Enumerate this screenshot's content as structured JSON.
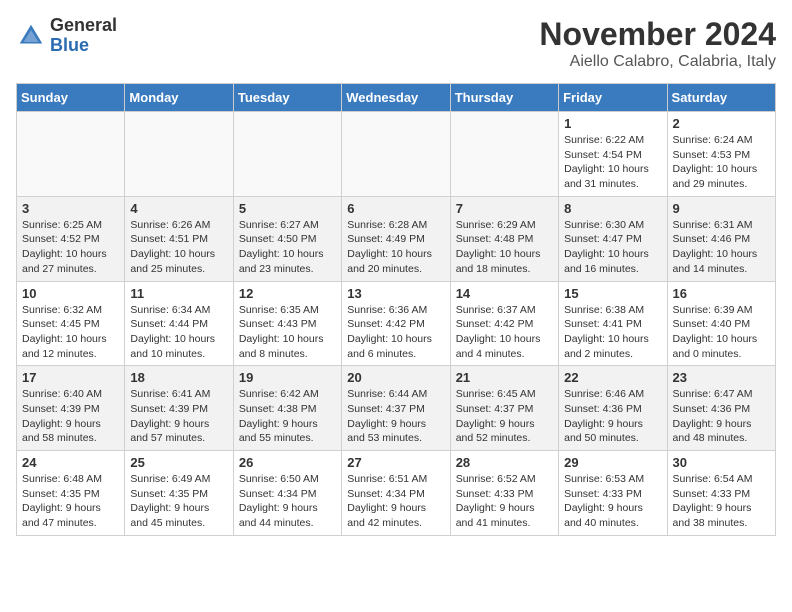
{
  "logo": {
    "general": "General",
    "blue": "Blue"
  },
  "title": "November 2024",
  "location": "Aiello Calabro, Calabria, Italy",
  "headers": [
    "Sunday",
    "Monday",
    "Tuesday",
    "Wednesday",
    "Thursday",
    "Friday",
    "Saturday"
  ],
  "weeks": [
    [
      {
        "day": "",
        "info": ""
      },
      {
        "day": "",
        "info": ""
      },
      {
        "day": "",
        "info": ""
      },
      {
        "day": "",
        "info": ""
      },
      {
        "day": "",
        "info": ""
      },
      {
        "day": "1",
        "info": "Sunrise: 6:22 AM\nSunset: 4:54 PM\nDaylight: 10 hours and 31 minutes."
      },
      {
        "day": "2",
        "info": "Sunrise: 6:24 AM\nSunset: 4:53 PM\nDaylight: 10 hours and 29 minutes."
      }
    ],
    [
      {
        "day": "3",
        "info": "Sunrise: 6:25 AM\nSunset: 4:52 PM\nDaylight: 10 hours and 27 minutes."
      },
      {
        "day": "4",
        "info": "Sunrise: 6:26 AM\nSunset: 4:51 PM\nDaylight: 10 hours and 25 minutes."
      },
      {
        "day": "5",
        "info": "Sunrise: 6:27 AM\nSunset: 4:50 PM\nDaylight: 10 hours and 23 minutes."
      },
      {
        "day": "6",
        "info": "Sunrise: 6:28 AM\nSunset: 4:49 PM\nDaylight: 10 hours and 20 minutes."
      },
      {
        "day": "7",
        "info": "Sunrise: 6:29 AM\nSunset: 4:48 PM\nDaylight: 10 hours and 18 minutes."
      },
      {
        "day": "8",
        "info": "Sunrise: 6:30 AM\nSunset: 4:47 PM\nDaylight: 10 hours and 16 minutes."
      },
      {
        "day": "9",
        "info": "Sunrise: 6:31 AM\nSunset: 4:46 PM\nDaylight: 10 hours and 14 minutes."
      }
    ],
    [
      {
        "day": "10",
        "info": "Sunrise: 6:32 AM\nSunset: 4:45 PM\nDaylight: 10 hours and 12 minutes."
      },
      {
        "day": "11",
        "info": "Sunrise: 6:34 AM\nSunset: 4:44 PM\nDaylight: 10 hours and 10 minutes."
      },
      {
        "day": "12",
        "info": "Sunrise: 6:35 AM\nSunset: 4:43 PM\nDaylight: 10 hours and 8 minutes."
      },
      {
        "day": "13",
        "info": "Sunrise: 6:36 AM\nSunset: 4:42 PM\nDaylight: 10 hours and 6 minutes."
      },
      {
        "day": "14",
        "info": "Sunrise: 6:37 AM\nSunset: 4:42 PM\nDaylight: 10 hours and 4 minutes."
      },
      {
        "day": "15",
        "info": "Sunrise: 6:38 AM\nSunset: 4:41 PM\nDaylight: 10 hours and 2 minutes."
      },
      {
        "day": "16",
        "info": "Sunrise: 6:39 AM\nSunset: 4:40 PM\nDaylight: 10 hours and 0 minutes."
      }
    ],
    [
      {
        "day": "17",
        "info": "Sunrise: 6:40 AM\nSunset: 4:39 PM\nDaylight: 9 hours and 58 minutes."
      },
      {
        "day": "18",
        "info": "Sunrise: 6:41 AM\nSunset: 4:39 PM\nDaylight: 9 hours and 57 minutes."
      },
      {
        "day": "19",
        "info": "Sunrise: 6:42 AM\nSunset: 4:38 PM\nDaylight: 9 hours and 55 minutes."
      },
      {
        "day": "20",
        "info": "Sunrise: 6:44 AM\nSunset: 4:37 PM\nDaylight: 9 hours and 53 minutes."
      },
      {
        "day": "21",
        "info": "Sunrise: 6:45 AM\nSunset: 4:37 PM\nDaylight: 9 hours and 52 minutes."
      },
      {
        "day": "22",
        "info": "Sunrise: 6:46 AM\nSunset: 4:36 PM\nDaylight: 9 hours and 50 minutes."
      },
      {
        "day": "23",
        "info": "Sunrise: 6:47 AM\nSunset: 4:36 PM\nDaylight: 9 hours and 48 minutes."
      }
    ],
    [
      {
        "day": "24",
        "info": "Sunrise: 6:48 AM\nSunset: 4:35 PM\nDaylight: 9 hours and 47 minutes."
      },
      {
        "day": "25",
        "info": "Sunrise: 6:49 AM\nSunset: 4:35 PM\nDaylight: 9 hours and 45 minutes."
      },
      {
        "day": "26",
        "info": "Sunrise: 6:50 AM\nSunset: 4:34 PM\nDaylight: 9 hours and 44 minutes."
      },
      {
        "day": "27",
        "info": "Sunrise: 6:51 AM\nSunset: 4:34 PM\nDaylight: 9 hours and 42 minutes."
      },
      {
        "day": "28",
        "info": "Sunrise: 6:52 AM\nSunset: 4:33 PM\nDaylight: 9 hours and 41 minutes."
      },
      {
        "day": "29",
        "info": "Sunrise: 6:53 AM\nSunset: 4:33 PM\nDaylight: 9 hours and 40 minutes."
      },
      {
        "day": "30",
        "info": "Sunrise: 6:54 AM\nSunset: 4:33 PM\nDaylight: 9 hours and 38 minutes."
      }
    ]
  ]
}
